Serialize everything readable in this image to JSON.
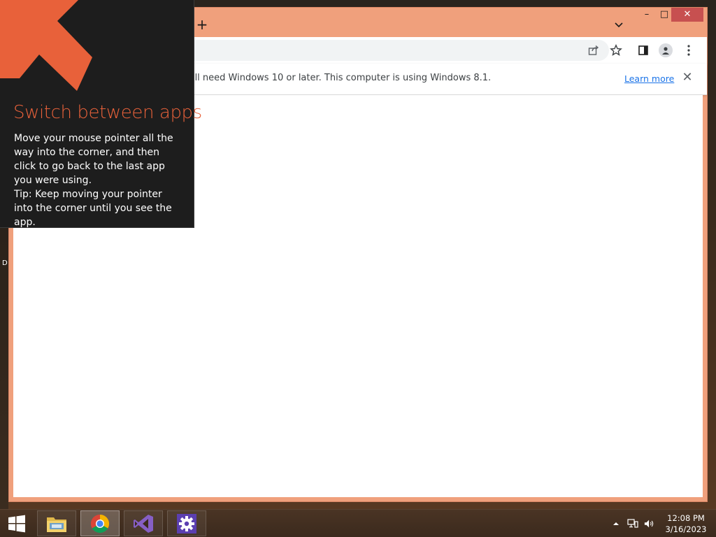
{
  "desktop": {
    "edge_label": "D"
  },
  "browser": {
    "new_tab_glyph": "+",
    "tab_search_icon": "chevron-down-icon",
    "window_controls": {
      "minimize_glyph": "–",
      "maximize_glyph": "□",
      "close_glyph": "✕"
    },
    "toolbar_icons": [
      "share-icon",
      "bookmark-star-icon",
      "side-panel-icon",
      "profile-icon",
      "menu-icon"
    ],
    "infobar": {
      "message": "'ll need Windows 10 or later. This computer is using Windows 8.1.",
      "learn_more": "Learn more",
      "close_glyph": "✕"
    },
    "frame_color": "#f0a07c"
  },
  "tip": {
    "title": "Switch between apps",
    "body_line1": "Move your mouse pointer all the way into the corner, and then click to go back to the last app you were using.",
    "body_line2": "Tip: Keep moving your pointer into the corner until you see the app.",
    "accent_color": "#e8613a"
  },
  "taskbar": {
    "apps": [
      {
        "name": "File Explorer",
        "icon": "folder-icon",
        "state": "pinned"
      },
      {
        "name": "Google Chrome",
        "icon": "chrome-icon",
        "state": "active"
      },
      {
        "name": "Visual Studio",
        "icon": "visual-studio-icon",
        "state": "pinned"
      },
      {
        "name": "Settings",
        "icon": "gear-icon",
        "state": "pinned"
      }
    ],
    "tray": {
      "time": "12:08 PM",
      "date": "3/16/2023"
    }
  }
}
